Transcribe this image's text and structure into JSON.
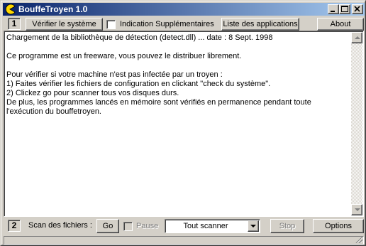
{
  "window": {
    "title": "BouffeTroyen 1.0"
  },
  "toolbar": {
    "section1_number": "1",
    "verify_label": "Vérifier le système",
    "extra_info_label": "Indication Supplémentaires",
    "extra_info_checked": false,
    "app_list_label": "Liste des applications",
    "about_label": "About"
  },
  "log": {
    "lines": [
      "Chargement de la bibliothèque de détection (detect.dll) ... date : 8 Sept. 1998",
      "",
      "Ce programme est un freeware, vous pouvez le distribuer librement.",
      "",
      "Pour vérifier si votre machine n'est pas infectée par un troyen :",
      "1) Faites vérifier les fichiers de configuration en clickant \"check du système\".",
      "2) Clickez go pour scanner tous vos disques durs.",
      "De plus, les programmes lancés en mémoire sont vérifiés en permanence pendant toute l'exécution du bouffetroyen."
    ]
  },
  "scanbar": {
    "section2_number": "2",
    "scan_label": "Scan des fichiers :",
    "go_label": "Go",
    "pause_label": "Pause",
    "pause_checked": false,
    "scope_selected": "Tout scanner",
    "stop_label": "Stop",
    "options_label": "Options"
  },
  "colors": {
    "title_gradient_start": "#0a246a",
    "title_gradient_end": "#a6caf0",
    "face": "#d4d0c8",
    "icon_yellow": "#ffd800"
  },
  "icons": {
    "app": "pacman-icon",
    "minimize": "minimize-icon",
    "maximize": "maximize-icon",
    "close": "close-icon"
  }
}
